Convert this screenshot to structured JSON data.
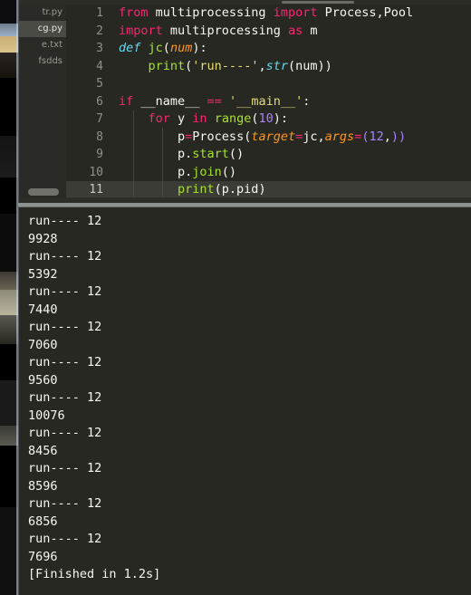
{
  "window": {
    "app_kind": "code-editor-with-build-output"
  },
  "sidebar": {
    "files": [
      {
        "name": "tr.py",
        "selected": false
      },
      {
        "name": "cg.py",
        "selected": true
      },
      {
        "name": "e.txt",
        "selected": false
      },
      {
        "name": "fsdds",
        "selected": false
      }
    ]
  },
  "editor": {
    "line_numbers": [
      "1",
      "2",
      "3",
      "4",
      "5",
      "6",
      "7",
      "8",
      "9",
      "10",
      "11"
    ],
    "active_line": "11",
    "lines": [
      {
        "n": "1",
        "tokens": [
          {
            "t": "from",
            "c": "t-kw"
          },
          {
            "t": " multiprocessing ",
            "c": "t-plain"
          },
          {
            "t": "import",
            "c": "t-kw"
          },
          {
            "t": " Process,Pool",
            "c": "t-plain"
          }
        ]
      },
      {
        "n": "2",
        "tokens": [
          {
            "t": "import",
            "c": "t-kw"
          },
          {
            "t": " multiprocessing ",
            "c": "t-plain"
          },
          {
            "t": "as",
            "c": "t-kw"
          },
          {
            "t": " m",
            "c": "t-plain"
          }
        ]
      },
      {
        "n": "3",
        "tokens": [
          {
            "t": "def",
            "c": "t-def"
          },
          {
            "t": " ",
            "c": "t-plain"
          },
          {
            "t": "jc",
            "c": "t-fn"
          },
          {
            "t": "(",
            "c": "t-punc"
          },
          {
            "t": "num",
            "c": "t-param"
          },
          {
            "t": "):",
            "c": "t-punc"
          }
        ]
      },
      {
        "n": "4",
        "tokens": [
          {
            "t": "    ",
            "c": "t-plain"
          },
          {
            "t": "print",
            "c": "t-call"
          },
          {
            "t": "(",
            "c": "t-punc"
          },
          {
            "t": "'run----'",
            "c": "t-str"
          },
          {
            "t": ",",
            "c": "t-punc"
          },
          {
            "t": "str",
            "c": "t-bi"
          },
          {
            "t": "(num))",
            "c": "t-punc"
          }
        ]
      },
      {
        "n": "5",
        "tokens": [
          {
            "t": "",
            "c": "t-plain"
          }
        ]
      },
      {
        "n": "6",
        "tokens": [
          {
            "t": "if",
            "c": "t-kw"
          },
          {
            "t": " __name__ ",
            "c": "t-plain"
          },
          {
            "t": "==",
            "c": "t-op"
          },
          {
            "t": " ",
            "c": "t-plain"
          },
          {
            "t": "'__main__'",
            "c": "t-str"
          },
          {
            "t": ":",
            "c": "t-punc"
          }
        ]
      },
      {
        "n": "7",
        "tokens": [
          {
            "t": "    ",
            "c": "t-plain"
          },
          {
            "t": "for",
            "c": "t-kw"
          },
          {
            "t": " y ",
            "c": "t-plain"
          },
          {
            "t": "in",
            "c": "t-kw"
          },
          {
            "t": " ",
            "c": "t-plain"
          },
          {
            "t": "range",
            "c": "t-call"
          },
          {
            "t": "(",
            "c": "t-punc"
          },
          {
            "t": "10",
            "c": "t-num"
          },
          {
            "t": "):",
            "c": "t-punc"
          }
        ]
      },
      {
        "n": "8",
        "tokens": [
          {
            "t": "        p",
            "c": "t-plain"
          },
          {
            "t": "=",
            "c": "t-op"
          },
          {
            "t": "Process",
            "c": "t-plain"
          },
          {
            "t": "(",
            "c": "t-punc"
          },
          {
            "t": "target",
            "c": "t-param"
          },
          {
            "t": "=",
            "c": "t-op"
          },
          {
            "t": "jc",
            "c": "t-plain"
          },
          {
            "t": ",",
            "c": "t-punc"
          },
          {
            "t": "args",
            "c": "t-param"
          },
          {
            "t": "=",
            "c": "t-op"
          },
          {
            "t": "(",
            "c": "t-num"
          },
          {
            "t": "12",
            "c": "t-num"
          },
          {
            "t": ",",
            "c": "t-punc"
          },
          {
            "t": "))",
            "c": "t-num"
          }
        ]
      },
      {
        "n": "9",
        "tokens": [
          {
            "t": "        p.",
            "c": "t-plain"
          },
          {
            "t": "start",
            "c": "t-call"
          },
          {
            "t": "()",
            "c": "t-punc"
          }
        ]
      },
      {
        "n": "10",
        "tokens": [
          {
            "t": "        p.",
            "c": "t-plain"
          },
          {
            "t": "join",
            "c": "t-call"
          },
          {
            "t": "()",
            "c": "t-punc"
          }
        ]
      },
      {
        "n": "11",
        "tokens": [
          {
            "t": "        ",
            "c": "t-plain"
          },
          {
            "t": "print",
            "c": "t-call"
          },
          {
            "t": "(p.pid)",
            "c": "t-punc"
          }
        ]
      }
    ]
  },
  "console": {
    "output_lines": [
      "run---- 12",
      "9928",
      "run---- 12",
      "5392",
      "run---- 12",
      "7440",
      "run---- 12",
      "7060",
      "run---- 12",
      "9560",
      "run---- 12",
      "10076",
      "run---- 12",
      "8456",
      "run---- 12",
      "8596",
      "run---- 12",
      "6856",
      "run---- 12",
      "7696",
      "[Finished in 1.2s]"
    ]
  },
  "colors": {
    "editor_bg": "#272822",
    "sidebar_bg": "#2a2b26",
    "selected_file_bg": "#4a4b44",
    "active_line_bg": "#3b3c35",
    "keyword": "#f92672",
    "string": "#e6db74",
    "number": "#ae81ff",
    "function": "#a6e22e",
    "builtin": "#66d9ef",
    "param": "#fd971f",
    "text": "#f8f8f2"
  }
}
